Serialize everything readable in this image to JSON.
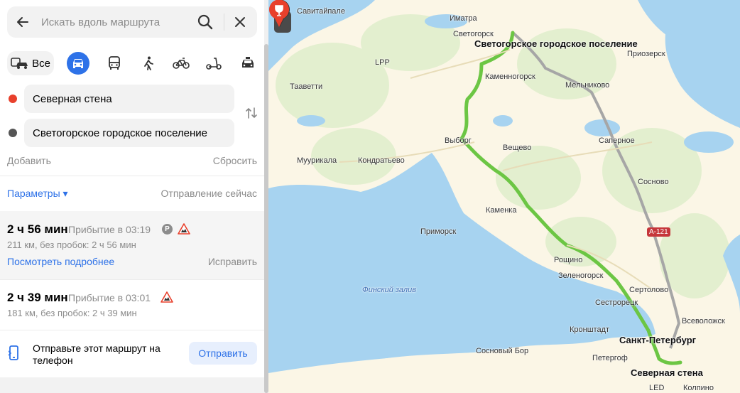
{
  "search": {
    "placeholder": "Искать вдоль маршрута"
  },
  "icons": {
    "back": "arrow-left-icon",
    "search": "search-icon",
    "close": "close-icon",
    "car": "car-icon",
    "bus": "bus-icon",
    "walk": "walk-icon",
    "bike": "bike-icon",
    "scooter": "scooter-icon",
    "taxi": "taxi-icon",
    "swap": "swap-icon",
    "phone": "phone-icon"
  },
  "modes": {
    "all_label": "Все"
  },
  "waypoints": {
    "from": "Северная стена",
    "to": "Светогорское городское поселение"
  },
  "actions": {
    "add": "Добавить",
    "reset": "Сбросить"
  },
  "options": {
    "params": "Параметры ▾",
    "depart": "Отправление сейчас"
  },
  "routes": [
    {
      "time": "2 ч 56 мин",
      "arrival": "Прибытие в 03:19",
      "info": "211 км, без пробок: 2 ч 56 мин",
      "details": "Посмотреть подробнее",
      "fix": "Исправить",
      "badge": "P"
    },
    {
      "time": "2 ч 39 мин",
      "arrival": "Прибытие в 03:01",
      "info": "181 км, без пробок: 2 ч 39 мин"
    }
  ],
  "share": {
    "text": "Отправьте этот маршрут на телефон",
    "button": "Отправить"
  },
  "colors": {
    "accent": "#2e72e8",
    "route_main": "#6cc644",
    "route_alt": "#a6a6a6",
    "water": "#a7d3f0",
    "land": "#fbf6e6",
    "forest": "#e3efcf",
    "end_pin": "#e8402c"
  },
  "map": {
    "start_label": "Светогорское городское поселение",
    "end_label": "Северная стена",
    "places": {
      "savitaipale": "Савитайпале",
      "imatra": "Иматра",
      "svetogorsk": "Светогорск",
      "lpp": "LPP",
      "priozersk": "Приозерск",
      "kamennogorsk": "Каменногорск",
      "taavetti": "Тааветти",
      "melnikovo": "Мельниково",
      "vyborg": "Выборг",
      "sapernoe": "Саперное",
      "veshchevo": "Вещево",
      "muurikkala": "Муурикала",
      "kondratievo": "Кондратьево",
      "sosnovo": "Сосново",
      "kamenka": "Каменка",
      "primorsk": "Приморск",
      "a121": "A-121",
      "roshchino": "Рощино",
      "zelenogorsk": "Зеленогорск",
      "gulf": "Финский залив",
      "sertolovo": "Сертолово",
      "sestroretsk": "Сестрорецк",
      "kronstadt": "Кронштадт",
      "vsevolozhsk": "Всеволожск",
      "spb": "Санкт-Петербург",
      "sosnovy_bor": "Сосновый Бор",
      "peterhof": "Петергоф",
      "led": "LED",
      "kolpino": "Колпино"
    }
  }
}
